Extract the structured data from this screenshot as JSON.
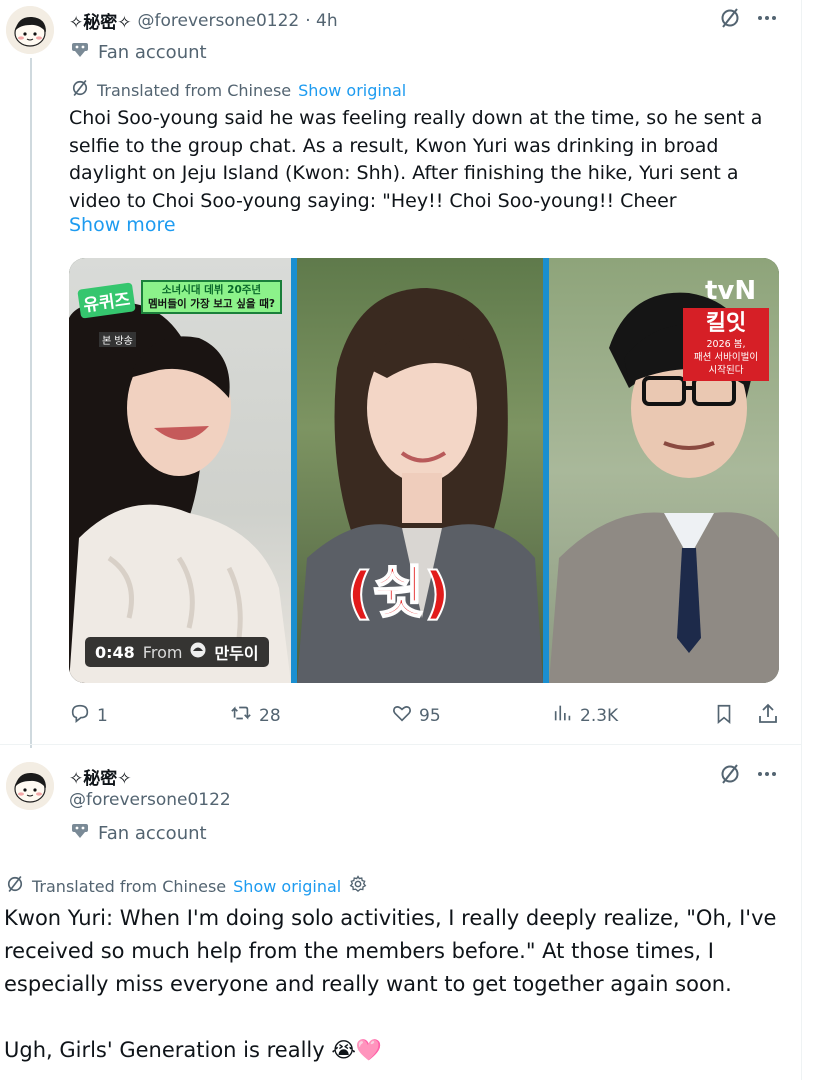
{
  "post1": {
    "display_name": "✧秘密✧",
    "handle": "@foreversone0122",
    "time": "· 4h",
    "badge_label": "Fan account",
    "translated_label": "Translated from Chinese",
    "show_original": "Show original",
    "text": "Choi Soo-young said he was feeling really down at the time, so he sent a selfie to the group chat. As a result, Kwon Yuri was drinking in broad daylight on Jeju Island (Kwon: Shh). After finishing the hike, Yuri sent a video to Choi Soo-young saying: \"Hey!! Choi Soo-young!! Cheer",
    "show_more": "Show more",
    "video": {
      "duration": "0:48",
      "from_label": "From",
      "source_name": "만두이",
      "left_logo": "유퀴즈",
      "left_caption_line1": "소녀시대 데뷔 20주년",
      "left_caption_line2": "멤버들이 가장 보고 싶을 때?",
      "left_small": "본 방송",
      "right_network": "tvN",
      "right_show": "킬잇",
      "right_sub_line1": "2026 봄,",
      "right_sub_line2": "패션 서바이벌이",
      "right_sub_line3": "시작된다",
      "center_caption": "(쉿)"
    },
    "actions": {
      "replies": "1",
      "reposts": "28",
      "likes": "95",
      "views": "2.3K"
    }
  },
  "post2": {
    "display_name": "✧秘密✧",
    "handle": "@foreversone0122",
    "badge_label": "Fan account",
    "translated_label": "Translated from Chinese",
    "show_original": "Show original",
    "paragraph1": "Kwon Yuri: When I'm doing solo activities, I really deeply realize, \"Oh, I've received so much help from the members before.\" At those times, I especially miss everyone and really want to get together again soon.",
    "paragraph2": "Ugh, Girls' Generation is really 😭🩷"
  },
  "colors": {
    "accent": "#1d9bf0",
    "muted": "#536471",
    "text": "#0f1419"
  }
}
